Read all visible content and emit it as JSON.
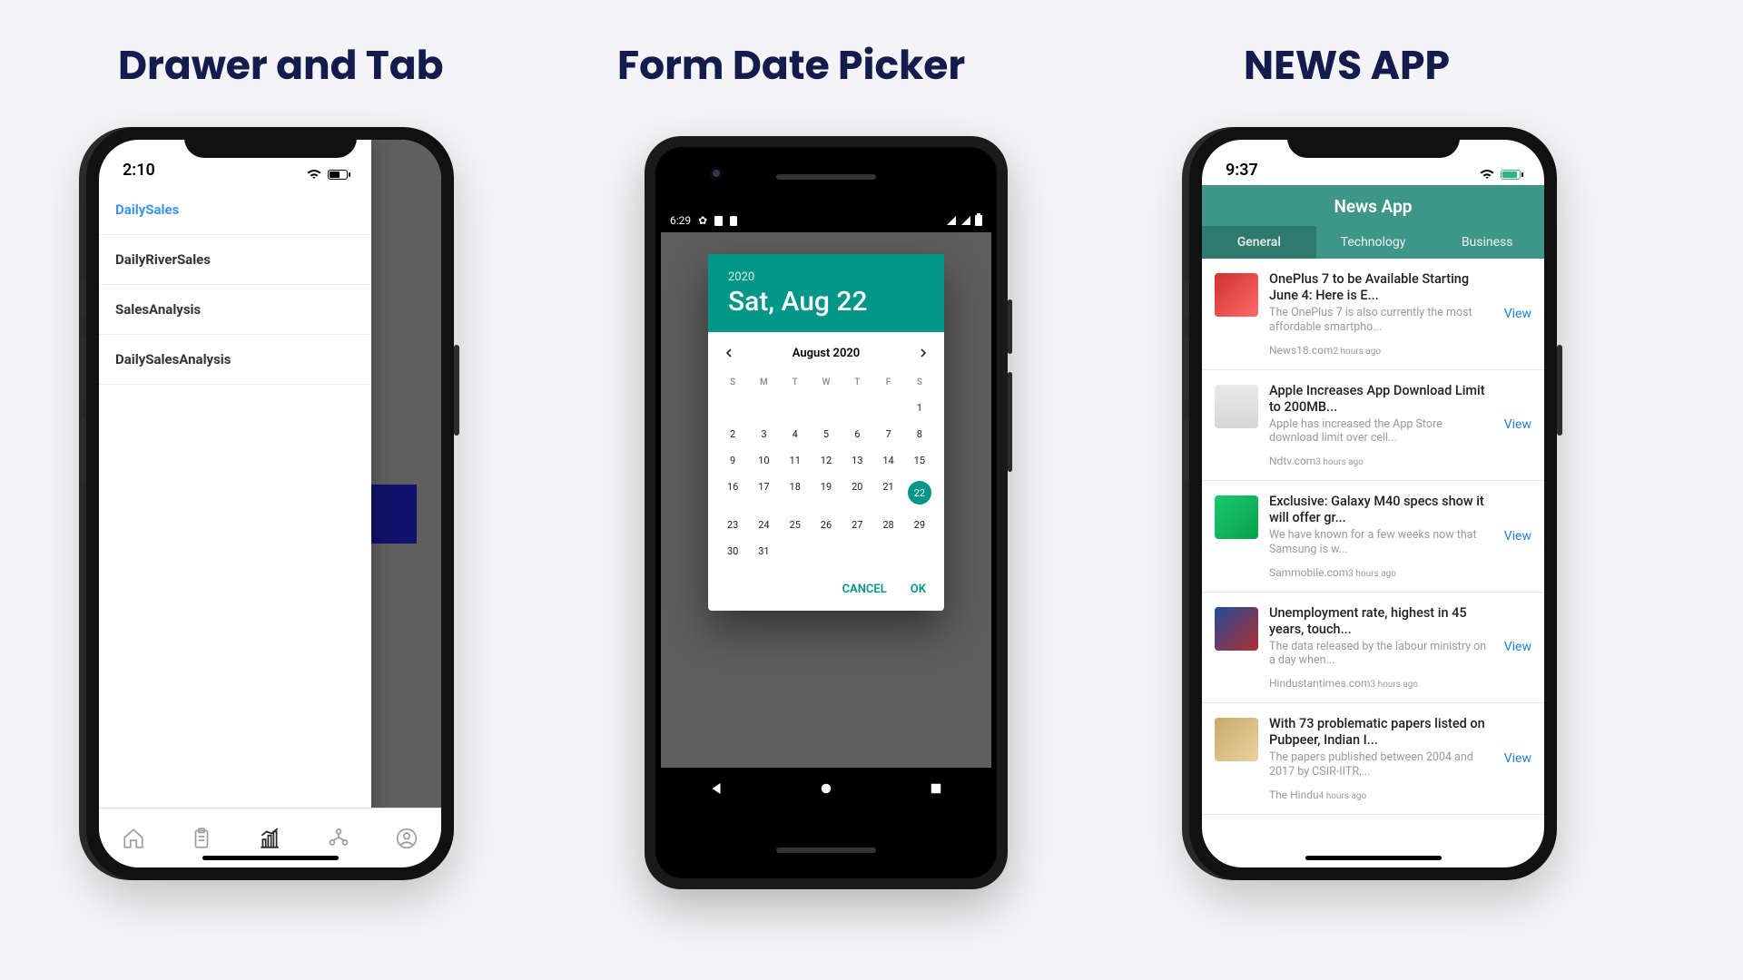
{
  "headings": {
    "h1": "Drawer and Tab",
    "h2": "Form Date Picker",
    "h3": "NEWS APP"
  },
  "phone1": {
    "time": "2:10",
    "drawer_items": [
      "DailySales",
      "DailyRiverSales",
      "SalesAnalysis",
      "DailySalesAnalysis"
    ],
    "active_index": 0
  },
  "phone2": {
    "status_time": "6:29",
    "year": "2020",
    "full_date": "Sat, Aug 22",
    "month_label": "August 2020",
    "dow": [
      "S",
      "M",
      "T",
      "W",
      "T",
      "F",
      "S"
    ],
    "weeks": [
      [
        "",
        "",
        "",
        "",
        "",
        "",
        "1"
      ],
      [
        "2",
        "3",
        "4",
        "5",
        "6",
        "7",
        "8"
      ],
      [
        "9",
        "10",
        "11",
        "12",
        "13",
        "14",
        "15"
      ],
      [
        "16",
        "17",
        "18",
        "19",
        "20",
        "21",
        "22"
      ],
      [
        "23",
        "24",
        "25",
        "26",
        "27",
        "28",
        "29"
      ],
      [
        "30",
        "31",
        "",
        "",
        "",
        "",
        ""
      ]
    ],
    "selected": "22",
    "cancel": "CANCEL",
    "ok": "OK"
  },
  "phone3": {
    "time": "9:37",
    "app_title": "News App",
    "tabs": [
      "General",
      "Technology",
      "Business"
    ],
    "active_tab": 0,
    "view_label": "View",
    "articles": [
      {
        "title": "OnePlus 7 to be Available Starting June 4: Here is E...",
        "desc": "The OnePlus 7 is also currently the most affordable smartpho...",
        "source": "News18.com",
        "time": "2 hours ago",
        "thumb": "thumb-a"
      },
      {
        "title": "Apple Increases App Download Limit to 200MB...",
        "desc": "Apple has increased the App Store download limit over cell...",
        "source": "Ndtv.com",
        "time": "3 hours ago",
        "thumb": "thumb-b"
      },
      {
        "title": "Exclusive: Galaxy M40 specs show it will offer gr...",
        "desc": "We have known for a few weeks now that Samsung is w...",
        "source": "Sammobile.com",
        "time": "3 hours ago",
        "thumb": "thumb-c"
      },
      {
        "title": "Unemployment rate, highest in 45 years, touch...",
        "desc": "The data released by the labour ministry on a day when...",
        "source": "Hindustantimes.com",
        "time": "3 hours ago",
        "thumb": "thumb-d"
      },
      {
        "title": "With 73 problematic papers listed on Pubpeer, Indian I...",
        "desc": "The papers published between 2004 and 2017 by CSIR-IITR,...",
        "source": "The Hindu",
        "time": "4 hours ago",
        "thumb": "thumb-e"
      }
    ]
  }
}
